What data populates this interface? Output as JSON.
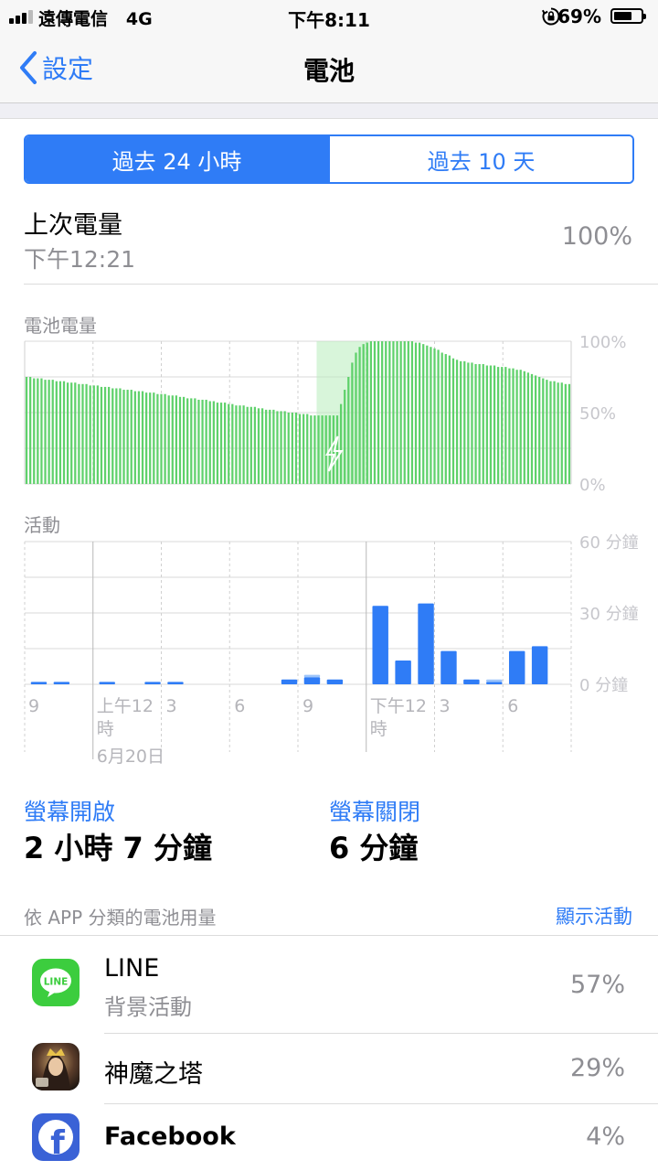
{
  "status_bar": {
    "carrier": "遠傳電信",
    "network": "4G",
    "time": "下午8:11",
    "battery_percent": "69%",
    "battery_level": 0.69
  },
  "nav": {
    "back_label": "設定",
    "title": "電池"
  },
  "segmented": {
    "option1": "過去 24 小時",
    "option2": "過去 10 天",
    "selected": 0
  },
  "last_charge": {
    "label": "上次電量",
    "time": "下午12:21",
    "value": "100%"
  },
  "battery_chart_title": "電池電量",
  "activity_chart_title": "活動",
  "chart_data": [
    {
      "type": "bar",
      "title": "電池電量",
      "y_tick_labels": [
        "100%",
        "50%",
        "0%"
      ],
      "ylim": [
        0,
        100
      ],
      "unit": "%",
      "grid": true,
      "bar_color": "#5fd16b",
      "charging_color": "#b8ecbc",
      "values": [
        75,
        75,
        74,
        74,
        74,
        73,
        73,
        73,
        72,
        72,
        72,
        71,
        71,
        71,
        70,
        70,
        70,
        69,
        69,
        69,
        68,
        68,
        68,
        67,
        67,
        67,
        66,
        66,
        66,
        65,
        65,
        65,
        64,
        64,
        64,
        63,
        63,
        63,
        62,
        62,
        62,
        61,
        61,
        60,
        60,
        60,
        59,
        59,
        59,
        58,
        58,
        57,
        57,
        57,
        56,
        56,
        55,
        55,
        55,
        54,
        54,
        54,
        53,
        53,
        52,
        52,
        52,
        51,
        51,
        51,
        50,
        50,
        50,
        49,
        49,
        49,
        48,
        48,
        48,
        48,
        48,
        48,
        48,
        48,
        56,
        66,
        75,
        85,
        92,
        96,
        98,
        99,
        100,
        100,
        100,
        100,
        100,
        100,
        100,
        100,
        100,
        100,
        100,
        100,
        99,
        99,
        98,
        97,
        96,
        95,
        94,
        92,
        91,
        90,
        88,
        87,
        86,
        86,
        85,
        85,
        84,
        84,
        84,
        83,
        83,
        83,
        82,
        82,
        82,
        81,
        81,
        80,
        80,
        79,
        78,
        77,
        76,
        75,
        74,
        73,
        72,
        72,
        71,
        71,
        70,
        70
      ],
      "charging_range": [
        78,
        92
      ]
    },
    {
      "type": "bar",
      "title": "活動",
      "y_tick_labels": [
        "60 分鐘",
        "30 分鐘",
        "0 分鐘"
      ],
      "ylim": [
        0,
        60
      ],
      "unit": "分鐘",
      "grid": true,
      "x_tick_labels": [
        "9",
        "上午12時",
        "3",
        "6",
        "9",
        "下午12時",
        "3",
        "6"
      ],
      "date_label": "6月20日",
      "series": [
        {
          "name": "螢幕開啟",
          "color": "#2f7cf6",
          "values": [
            1,
            1,
            0,
            1,
            0,
            1,
            1,
            0,
            0,
            0,
            0,
            2,
            3,
            2,
            0,
            33,
            10,
            34,
            14,
            2,
            1,
            14,
            16
          ]
        },
        {
          "name": "螢幕關閉",
          "color": "#9ec5fa",
          "values": [
            0,
            0,
            0,
            0,
            0,
            0,
            0,
            0,
            0,
            0,
            0,
            0,
            1,
            0,
            0,
            0,
            0,
            0,
            0,
            0,
            1,
            0,
            0
          ]
        }
      ]
    }
  ],
  "screen_on": {
    "label": "螢幕開啟",
    "value": "2 小時 7 分鐘"
  },
  "screen_off": {
    "label": "螢幕關閉",
    "value": "6 分鐘"
  },
  "usage_section": {
    "title": "依 APP 分類的電池用量",
    "action": "顯示活動"
  },
  "apps": [
    {
      "name": "LINE",
      "subtitle": "背景活動",
      "percent": "57%",
      "icon": "line-app-icon",
      "logo_text": "LINE"
    },
    {
      "name": "神魔之塔",
      "subtitle": "",
      "percent": "29%",
      "icon": "tower-of-saviors-app-icon"
    },
    {
      "name": "Facebook",
      "subtitle": "",
      "percent": "4%",
      "icon": "facebook-app-icon",
      "logo_text": "f"
    }
  ]
}
